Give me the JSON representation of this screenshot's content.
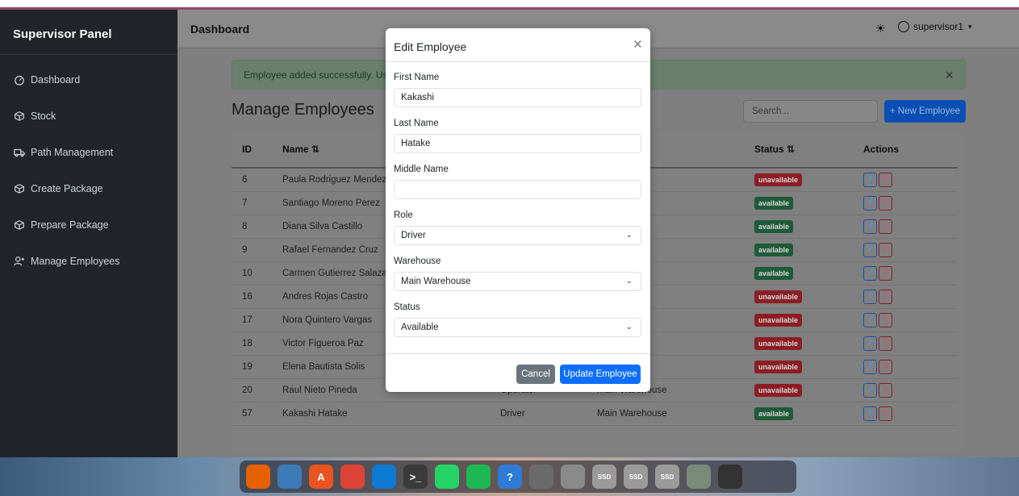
{
  "sidebar": {
    "brand": "Supervisor Panel",
    "items": [
      {
        "label": "Dashboard",
        "icon": "dashboard-gauge-icon"
      },
      {
        "label": "Stock",
        "icon": "box-icon"
      },
      {
        "label": "Path Management",
        "icon": "truck-icon"
      },
      {
        "label": "Create Package",
        "icon": "box-icon"
      },
      {
        "label": "Prepare Package",
        "icon": "box-icon"
      },
      {
        "label": "Manage Employees",
        "icon": "user-add-icon"
      }
    ]
  },
  "topbar": {
    "title": "Dashboard",
    "user": "supervisor1"
  },
  "alert": {
    "text": "Employee added successfully. Usernar"
  },
  "page": {
    "heading": "Manage Employees",
    "search_placeholder": "Search...",
    "new_button": "+ New Employee"
  },
  "table": {
    "headers": {
      "id": "ID",
      "name": "Name ⇅",
      "col3": "⇅",
      "status": "Status ⇅",
      "actions": "Actions"
    },
    "rows": [
      {
        "id": "6",
        "name": "Paula Rodriguez Mendez",
        "role": "",
        "warehouse": "use",
        "status": "unavailable"
      },
      {
        "id": "7",
        "name": "Santiago Moreno Perez",
        "role": "",
        "warehouse": "use",
        "status": "available"
      },
      {
        "id": "8",
        "name": "Diana Silva Castillo",
        "role": "",
        "warehouse": "use",
        "status": "available"
      },
      {
        "id": "9",
        "name": "Rafael Fernandez Cruz",
        "role": "",
        "warehouse": "use",
        "status": "available"
      },
      {
        "id": "10",
        "name": "Carmen Gutierrez Salazar",
        "role": "",
        "warehouse": "use",
        "status": "available"
      },
      {
        "id": "16",
        "name": "Andres Rojas Castro",
        "role": "",
        "warehouse": "use",
        "status": "unavailable"
      },
      {
        "id": "17",
        "name": "Nora Quintero Vargas",
        "role": "",
        "warehouse": "use",
        "status": "unavailable"
      },
      {
        "id": "18",
        "name": "Victor Figueroa Paz",
        "role": "",
        "warehouse": "use",
        "status": "unavailable"
      },
      {
        "id": "19",
        "name": "Elena Bautista Solis",
        "role": "",
        "warehouse": "use",
        "status": "unavailable"
      },
      {
        "id": "20",
        "name": "Raul Nieto Pineda",
        "role": "Operator",
        "warehouse": "Main Warehouse",
        "status": "unavailable"
      },
      {
        "id": "57",
        "name": "Kakashi Hatake",
        "role": "Driver",
        "warehouse": "Main Warehouse",
        "status": "available"
      }
    ]
  },
  "modal": {
    "title": "Edit Employee",
    "first_name_label": "First Name",
    "first_name_value": "Kakashi",
    "last_name_label": "Last Name",
    "last_name_value": "Hatake",
    "middle_name_label": "Middle Name",
    "middle_name_value": "",
    "role_label": "Role",
    "role_value": "Driver",
    "warehouse_label": "Warehouse",
    "warehouse_value": "Main Warehouse",
    "status_label": "Status",
    "status_value": "Available",
    "cancel": "Cancel",
    "update": "Update Employee"
  },
  "dock": {
    "apps": [
      {
        "name": "firefox-icon",
        "color": "#e66000",
        "glyph": ""
      },
      {
        "name": "files-icon",
        "color": "#3d7ab8",
        "glyph": ""
      },
      {
        "name": "app-store-icon",
        "color": "#e95420",
        "glyph": "A"
      },
      {
        "name": "chrome-icon",
        "color": "#db4437",
        "glyph": ""
      },
      {
        "name": "vscode-icon",
        "color": "#0e7ad3",
        "glyph": ""
      },
      {
        "name": "terminal-icon",
        "color": "#3b3b3b",
        "glyph": ">_"
      },
      {
        "name": "whatsapp-icon",
        "color": "#25d366",
        "glyph": ""
      },
      {
        "name": "spotify-icon",
        "color": "#1db954",
        "glyph": ""
      },
      {
        "name": "help-icon",
        "color": "#2f7bd8",
        "glyph": "?"
      },
      {
        "name": "settings-icon",
        "color": "#6a6a6a",
        "glyph": ""
      },
      {
        "name": "screenshot-icon",
        "color": "#8a8a8a",
        "glyph": ""
      },
      {
        "name": "disk-icon",
        "color": "#9a9a9a",
        "glyph": "SSD"
      },
      {
        "name": "disk-icon",
        "color": "#9a9a9a",
        "glyph": "SSD"
      },
      {
        "name": "disk-icon",
        "color": "#9a9a9a",
        "glyph": "SSD"
      },
      {
        "name": "trash-icon",
        "color": "#7a8a7a",
        "glyph": ""
      },
      {
        "name": "apps-grid-icon",
        "color": "#333333",
        "glyph": ""
      }
    ]
  }
}
